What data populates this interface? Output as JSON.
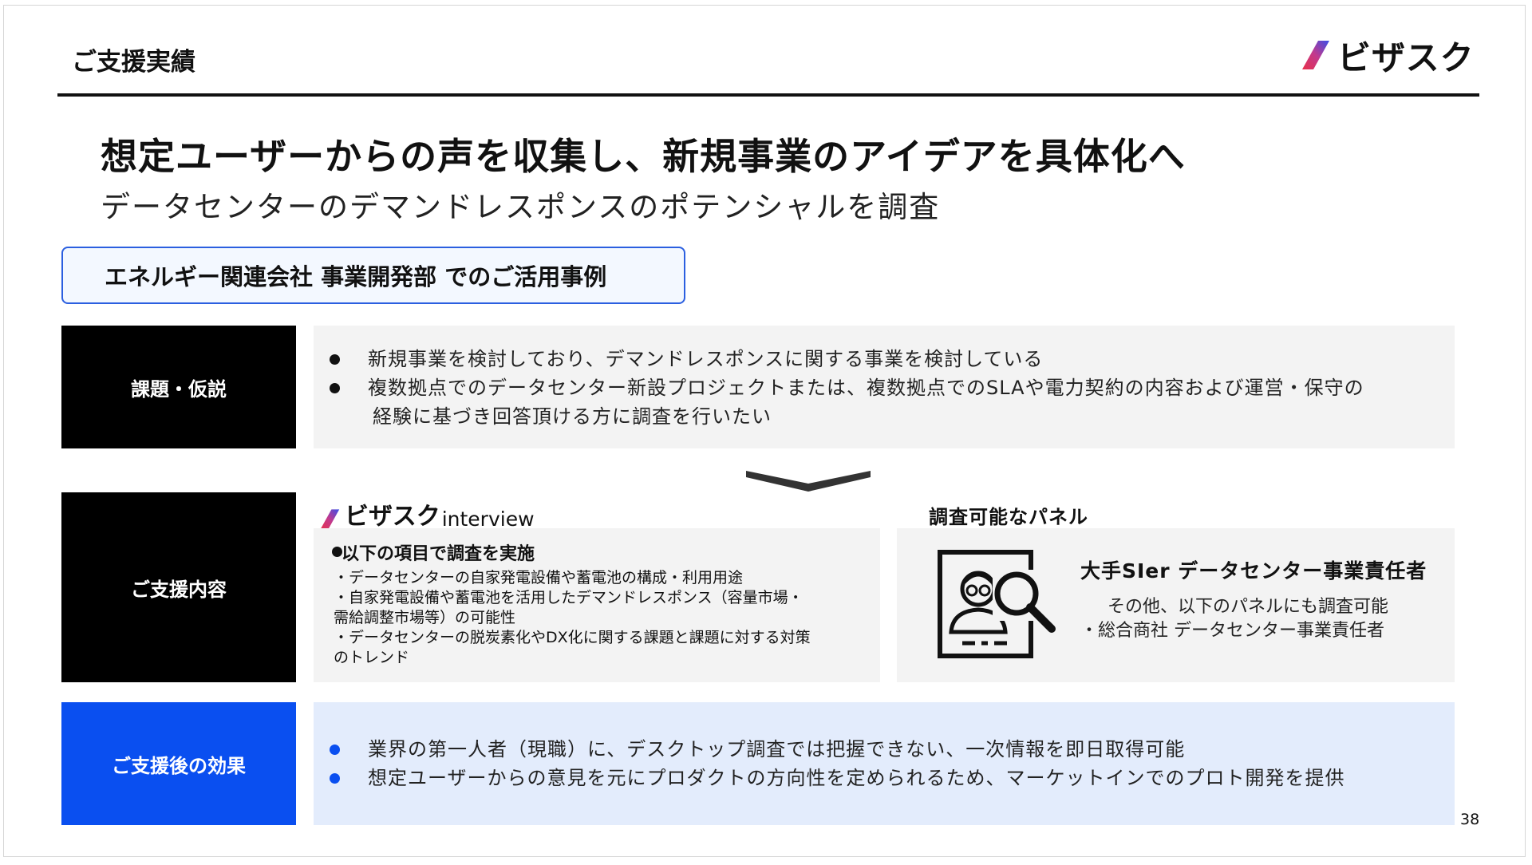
{
  "header": {
    "section_title": "ご支援実績",
    "logo_text": "ビザスク"
  },
  "headline": "想定ユーザーからの声を収集し、新規事業のアイデアを具体化へ",
  "subheadline": "データセンターのデマンドレスポンスのポテンシャルを調査",
  "case_label": "エネルギー関連会社 事業開発部 でのご活用事例",
  "rows": {
    "challenge": {
      "label": "課題・仮説",
      "bullets": [
        "新規事業を検討しており、デマンドレスポンスに関する事業を検討している",
        "複数拠点でのデータセンター新設プロジェクトまたは、複数拠点でのSLAや電力契約の内容および運営・保守の",
        "経験に基づき回答頂ける方に調査を行いたい"
      ]
    },
    "support": {
      "label": "ご支援内容",
      "logo_main": "ビザスク",
      "logo_sub": "interview",
      "bullet": "以下の項目で調査を実施",
      "items": [
        "・データセンターの自家発電設備や蓄電池の構成・利用用途",
        "・自家発電設備や蓄電池を活用したデマンドレスポンス（容量市場・",
        "需給調整市場等）の可能性",
        "・データセンターの脱炭素化やDX化に関する課題と課題に対する対策",
        "のトレンド"
      ],
      "panel_heading": "調査可能なパネル",
      "panel_title": "大手SIer データセンター事業責任者",
      "panel_others": [
        "その他、以下のパネルにも調査可能",
        "・総合商社 データセンター事業責任者"
      ],
      "panel_icon": "person-search-icon"
    },
    "effect": {
      "label": "ご支援後の効果",
      "bullets": [
        "業界の第一人者（現職）に、デスクトップ調査では把握できない、一次情報を即日取得可能",
        "想定ユーザーからの意見を元にプロダクトの方向性を定められるため、マーケットインでのプロト開発を提供"
      ]
    }
  },
  "page_number": "38",
  "colors": {
    "accent_blue": "#0a4ff0",
    "logo_gradient_start": "#e8304a",
    "logo_gradient_end": "#3a4fe8",
    "black_label": "#000000",
    "light_panel": "#f3f3f3",
    "blue_panel": "#e3ecfc"
  }
}
